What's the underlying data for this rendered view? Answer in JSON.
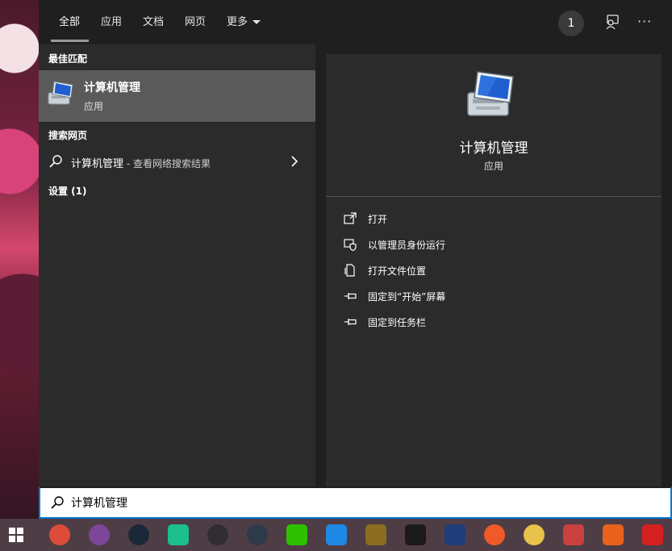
{
  "tabs": [
    {
      "label": "全部"
    },
    {
      "label": "应用"
    },
    {
      "label": "文档"
    },
    {
      "label": "网页"
    },
    {
      "label": "更多"
    }
  ],
  "badge_count": "1",
  "sections": {
    "best_match": "最佳匹配",
    "web_search": "搜索网页",
    "settings": "设置 (1)"
  },
  "best_match_item": {
    "title": "计算机管理",
    "subtitle": "应用"
  },
  "web_item": {
    "query": "计算机管理",
    "hint": " - 查看网络搜索结果"
  },
  "preview": {
    "title": "计算机管理",
    "subtitle": "应用",
    "actions": [
      {
        "label": "打开",
        "icon": "open-icon"
      },
      {
        "label": "以管理员身份运行",
        "icon": "shield-icon"
      },
      {
        "label": "打开文件位置",
        "icon": "file-location-icon"
      },
      {
        "label": "固定到“开始”屏幕",
        "icon": "pin-icon"
      },
      {
        "label": "固定到任务栏",
        "icon": "pin-icon"
      }
    ]
  },
  "search": {
    "value": "计算机管理"
  },
  "taskbar_apps": [
    {
      "name": "chrome",
      "color": "#dd4b39"
    },
    {
      "name": "tor",
      "color": "#7d4698"
    },
    {
      "name": "steam",
      "color": "#1b2838"
    },
    {
      "name": "app-green",
      "color": "#1bc08a"
    },
    {
      "name": "obs",
      "color": "#302e31"
    },
    {
      "name": "app-dark",
      "color": "#2d3a4a"
    },
    {
      "name": "wechat",
      "color": "#2dc100"
    },
    {
      "name": "app-blue",
      "color": "#1e88e5"
    },
    {
      "name": "app-game",
      "color": "#8a6d1f"
    },
    {
      "name": "intellij",
      "color": "#1a1a1a"
    },
    {
      "name": "devcpp",
      "color": "#1f3d7a"
    },
    {
      "name": "app-orange",
      "color": "#f05a28"
    },
    {
      "name": "app-yellow",
      "color": "#e8c24a"
    },
    {
      "name": "app-red",
      "color": "#c94040"
    },
    {
      "name": "matlab",
      "color": "#e8621e"
    },
    {
      "name": "app-red2",
      "color": "#d42020"
    }
  ],
  "accent": "#0078d4"
}
